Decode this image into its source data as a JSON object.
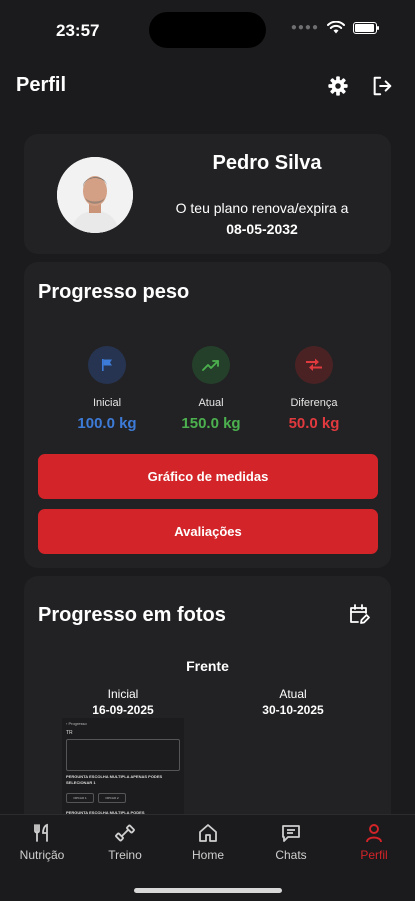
{
  "status_bar": {
    "time": "23:57"
  },
  "header": {
    "title": "Perfil",
    "settings_icon": "gear-icon",
    "logout_icon": "logout-icon"
  },
  "profile": {
    "name": "Pedro Silva",
    "renew_label": "O teu plano renova/expira a",
    "renew_date": "08-05-2032"
  },
  "weight_progress": {
    "title": "Progresso peso",
    "stats": [
      {
        "label": "Inicial",
        "value": "100.0 kg",
        "color": "#3d7bd8",
        "icon": "flag-icon"
      },
      {
        "label": "Atual",
        "value": "150.0 kg",
        "color": "#4cb04f",
        "icon": "trending-up-icon"
      },
      {
        "label": "Diferença",
        "value": "50.0 kg",
        "color": "#e0393e",
        "icon": "compare-arrows-icon"
      }
    ],
    "buttons": {
      "measures": "Gráfico de medidas",
      "evaluations": "Avaliações"
    }
  },
  "photo_progress": {
    "title": "Progresso em fotos",
    "face": "Frente",
    "initial": {
      "label": "Inicial",
      "date": "16-09-2025"
    },
    "current": {
      "label": "Atual",
      "date": "30-10-2025"
    },
    "thumbnail": {
      "line1": "‹ Progresso",
      "line2": "TR",
      "line3": "PERGUNTA ESCOLHA MULTIPLA APENAS PODES SELECIONAR 1",
      "opt1": "OPCAO 1",
      "opt2": "OPCAO 2",
      "line4": "PERGUNTA ESCOLHA MULTIPLA PODES"
    }
  },
  "tabs": [
    {
      "label": "Nutrição",
      "icon": "cutlery-icon"
    },
    {
      "label": "Treino",
      "icon": "dumbbell-icon"
    },
    {
      "label": "Home",
      "icon": "home-icon"
    },
    {
      "label": "Chats",
      "icon": "chat-icon"
    },
    {
      "label": "Perfil",
      "icon": "person-icon",
      "active": true
    }
  ],
  "colors": {
    "accent": "#d32429",
    "card": "#222224",
    "background": "#1b1b1d"
  }
}
